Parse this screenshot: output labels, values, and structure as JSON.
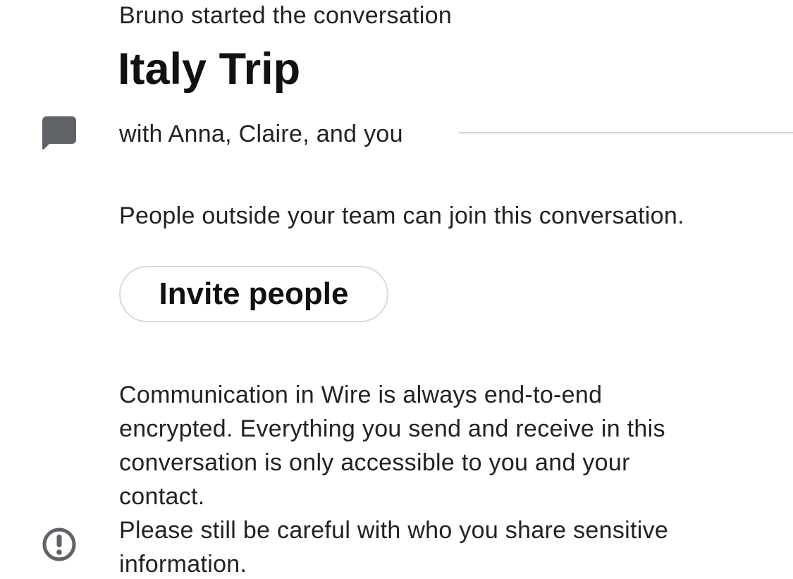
{
  "conversation": {
    "started_by": "Bruno started the conversation",
    "title": "Italy Trip",
    "participants": "with Anna, Claire, and you",
    "chat_icon": "chat-bubble-icon"
  },
  "guests": {
    "note": "People outside your team can join this conversation.",
    "invite_label": "Invite people"
  },
  "security": {
    "alert_icon": "exclamation-circle-icon",
    "lines": [
      "Communication in Wire is always end-to-end",
      "encrypted. Everything you send and receive in this",
      "conversation is only accessible to you and your",
      "contact.",
      "Please still be careful with who you share sensitive",
      "information."
    ]
  },
  "colors": {
    "icon_gray": "#5f6368",
    "divider": "#8a8a8a",
    "button_border": "#d9d9d9",
    "text": "#222222"
  }
}
